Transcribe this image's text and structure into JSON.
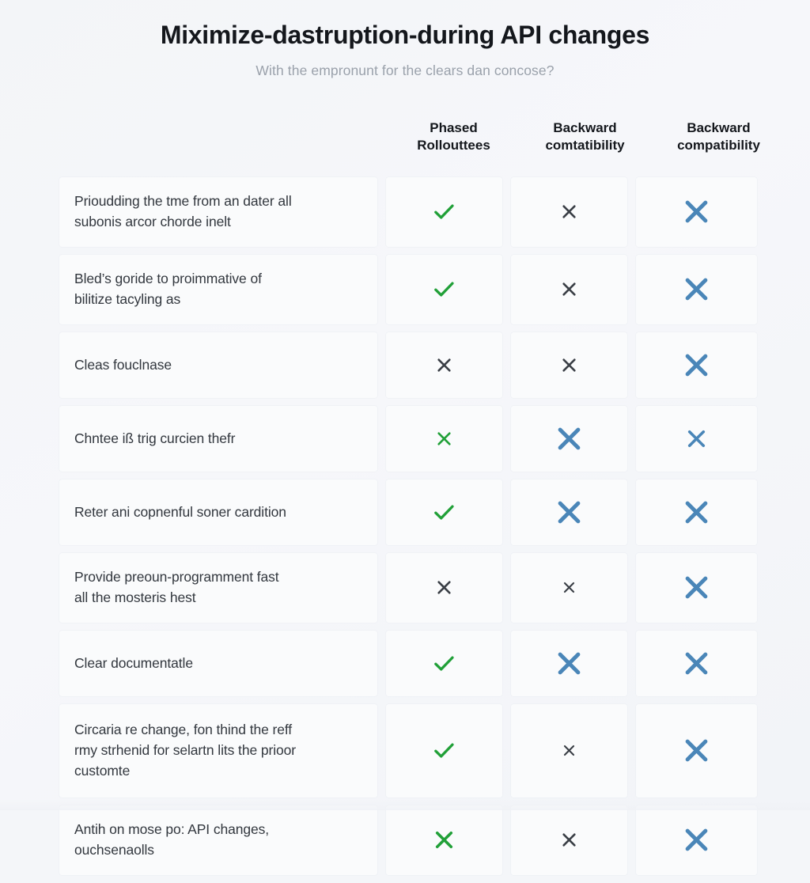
{
  "header": {
    "title": "Miximize-dastruption-during API changes",
    "subtitle": "With the empronunt for the clears dan concose?"
  },
  "colors": {
    "page_background": "#f4f6f9",
    "card_background": "#fafbfc",
    "title_text": "#14171c",
    "subtitle_text": "#9aa1ab",
    "body_text": "#32373e",
    "check_green": "#21a038",
    "cross_dark": "#3a3f46",
    "cross_blue": "#4a86b8"
  },
  "table": {
    "columns": [
      {
        "key": "description",
        "label": ""
      },
      {
        "key": "phased_rollouttees",
        "label": "Phased\nRollouttees",
        "line1": "Phased",
        "line2": "Rollouttees"
      },
      {
        "key": "backward_comtatibility",
        "label": "Backward\ncomtatibility",
        "line1": "Backward",
        "line2": "comtatibility"
      },
      {
        "key": "backward_compatibility",
        "label": "Backward\ncompatibility",
        "line1": "Backward",
        "line2": "compatibility"
      }
    ],
    "rows": [
      {
        "description_line1": "Prioudding the tme from an dater all",
        "description_line2": "subonis arcor chorde inelt",
        "marks": [
          {
            "icon": "check-icon",
            "color": "#21a038",
            "size": "medium"
          },
          {
            "icon": "cross-icon",
            "color": "#3a3f46",
            "size": "small"
          },
          {
            "icon": "cross-icon",
            "color": "#4a86b8",
            "size": "large"
          }
        ]
      },
      {
        "description_line1": "Bled’s goride to proimmative of",
        "description_line2": "bilitize tacyling as",
        "marks": [
          {
            "icon": "check-icon",
            "color": "#21a038",
            "size": "medium"
          },
          {
            "icon": "cross-icon",
            "color": "#3a3f46",
            "size": "small"
          },
          {
            "icon": "cross-icon",
            "color": "#4a86b8",
            "size": "large"
          }
        ]
      },
      {
        "description_line1": "Cleas fouclnase",
        "description_line2": "",
        "marks": [
          {
            "icon": "cross-icon",
            "color": "#3a3f46",
            "size": "small"
          },
          {
            "icon": "cross-icon",
            "color": "#3a3f46",
            "size": "small"
          },
          {
            "icon": "cross-icon",
            "color": "#4a86b8",
            "size": "large"
          }
        ]
      },
      {
        "description_line1": "Chntee iß trig curcien thefr",
        "description_line2": "",
        "marks": [
          {
            "icon": "cross-icon",
            "color": "#21a038",
            "size": "small"
          },
          {
            "icon": "cross-icon",
            "color": "#4a86b8",
            "size": "large"
          },
          {
            "icon": "cross-icon",
            "color": "#4a86b8",
            "size": "medium"
          }
        ]
      },
      {
        "description_line1": "Reter ani copnenful soner cardition",
        "description_line2": "",
        "marks": [
          {
            "icon": "check-icon",
            "color": "#21a038",
            "size": "medium"
          },
          {
            "icon": "cross-icon",
            "color": "#4a86b8",
            "size": "large"
          },
          {
            "icon": "cross-icon",
            "color": "#4a86b8",
            "size": "large"
          }
        ]
      },
      {
        "description_line1": "Provide preoun-programment fast",
        "description_line2": "all the mosteris hest",
        "marks": [
          {
            "icon": "cross-icon",
            "color": "#3a3f46",
            "size": "small"
          },
          {
            "icon": "cross-icon",
            "color": "#3a3f46",
            "size": "xsmall"
          },
          {
            "icon": "cross-icon",
            "color": "#4a86b8",
            "size": "large"
          }
        ]
      },
      {
        "description_line1": "Clear documentatle",
        "description_line2": "",
        "marks": [
          {
            "icon": "check-icon",
            "color": "#21a038",
            "size": "medium"
          },
          {
            "icon": "cross-icon",
            "color": "#4a86b8",
            "size": "large"
          },
          {
            "icon": "cross-icon",
            "color": "#4a86b8",
            "size": "large"
          }
        ]
      },
      {
        "description_line1": "Circaria re change, fon thind the reff",
        "description_line2": "rmy strhenid for selartn lits the prioor",
        "description_line3": "customte",
        "marks": [
          {
            "icon": "check-icon",
            "color": "#21a038",
            "size": "medium"
          },
          {
            "icon": "cross-icon",
            "color": "#3a3f46",
            "size": "xsmall"
          },
          {
            "icon": "cross-icon",
            "color": "#4a86b8",
            "size": "large"
          }
        ]
      },
      {
        "description_line1": "Antih on mose po: API changes,",
        "description_line2": "ouchsenaolls",
        "marks": [
          {
            "icon": "cross-icon",
            "color": "#21a038",
            "size": "medium"
          },
          {
            "icon": "cross-icon",
            "color": "#3a3f46",
            "size": "small"
          },
          {
            "icon": "cross-icon",
            "color": "#4a86b8",
            "size": "large"
          }
        ]
      }
    ]
  }
}
